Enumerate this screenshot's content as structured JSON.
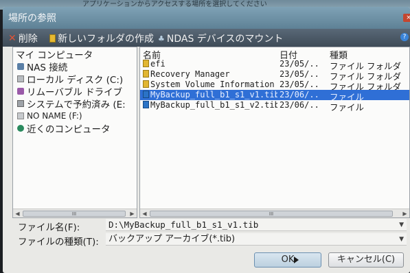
{
  "background": {
    "strip_text": "アプリケーションからアクセスする場所を選択してください"
  },
  "window": {
    "title": "場所の参照",
    "close_symbol": "×"
  },
  "toolbar": {
    "delete_label": "削除",
    "new_folder_label": "新しいフォルダの作成",
    "nas_mount_label": "NDAS デバイスのマウント",
    "help_symbol": "?"
  },
  "tree": {
    "root": "マイ コンピュータ",
    "items": [
      {
        "label": "NAS 接続",
        "icon": "nas-icon"
      },
      {
        "label": "ローカル ディスク (C:)",
        "icon": "local-disk-icon"
      },
      {
        "label": "リムーバブル ドライブ",
        "icon": "usb-drive-icon"
      },
      {
        "label": "システムで予約済み (E:",
        "icon": "system-drive-icon"
      },
      {
        "label": "NO NAME (F:)",
        "icon": "drive-icon"
      },
      {
        "label": "近くのコンピュータ",
        "icon": "network-icon"
      }
    ]
  },
  "file_list": {
    "columns": {
      "name": "名前",
      "date": "日付",
      "type": "種類"
    },
    "rows": [
      {
        "name": "efi",
        "date": "23/05/...",
        "type": "ファイル フォルダ",
        "icon": "folder-icon"
      },
      {
        "name": "Recovery Manager",
        "date": "23/05/...",
        "type": "ファイル フォルダ",
        "icon": "folder-icon"
      },
      {
        "name": "System Volume Information",
        "date": "23/05/...",
        "type": "ファイル フォルダ",
        "icon": "folder-icon"
      },
      {
        "name": "MyBackup_full_b1_s1_v1.tib",
        "date": "23/06/...",
        "type": "ファイル",
        "icon": "tib-file-icon",
        "selected": true
      },
      {
        "name": "MyBackup_full_b1_s1_v2.tib",
        "date": "23/06/...",
        "type": "ファイル",
        "icon": "tib-file-icon"
      }
    ]
  },
  "scrollbar": {
    "thumb_label": "III"
  },
  "fields": {
    "file_name_label": "ファイル名(F):",
    "file_name_value": "D:\\MyBackup_full_b1_s1_v1.tib",
    "file_type_label": "ファイルの種類(T):",
    "file_type_value": "バックアップ アーカイブ(*.tib)"
  },
  "buttons": {
    "ok": "OK",
    "cancel": "キャンセル(C)"
  },
  "colors": {
    "selection": "#2f6fd6",
    "toolbar": "#4a5866",
    "titlebar": "#6f93a8",
    "dialog_bg": "#e9e9e6"
  }
}
